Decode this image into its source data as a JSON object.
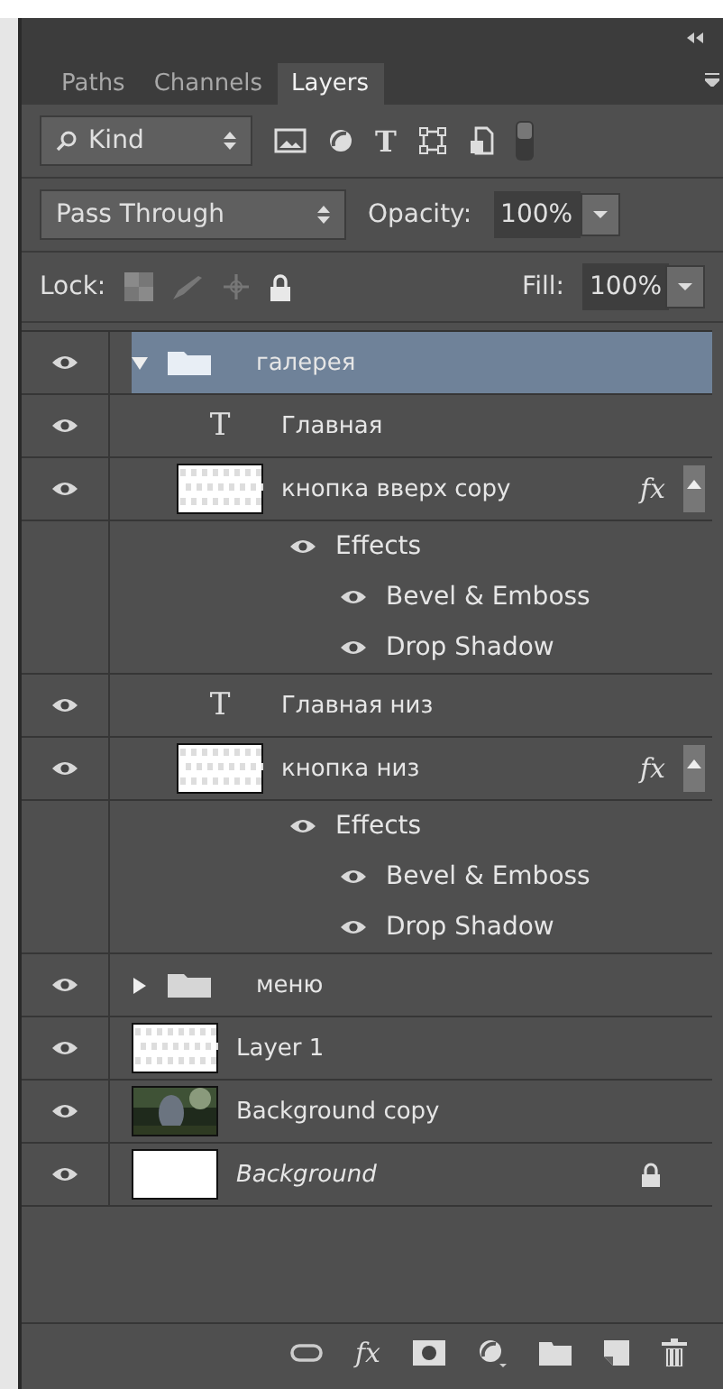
{
  "panel": {
    "tabs": [
      {
        "label": "Paths",
        "selected": false
      },
      {
        "label": "Channels",
        "selected": false
      },
      {
        "label": "Layers",
        "selected": true
      }
    ],
    "filter": {
      "label": "Kind",
      "type_glyph": "T"
    },
    "blend_mode": "Pass Through",
    "opacity_label": "Opacity:",
    "opacity": "100%",
    "lock_label": "Lock:",
    "fill_label": "Fill:",
    "fill": "100%"
  },
  "layers": [
    {
      "kind": "group",
      "name": "галерея",
      "visible": true,
      "selected": true,
      "expanded": true,
      "children": [
        {
          "kind": "text",
          "glyph": "T",
          "name": "Главная",
          "visible": true,
          "selected": false
        },
        {
          "kind": "pixel",
          "thumbnail": {
            "kind": "transparent"
          },
          "name": "кнопка вверх copy",
          "visible": true,
          "selected": false,
          "fx": "fx",
          "effects_expanded": true,
          "effects_label": "Effects",
          "effects": [
            {
              "name": "Bevel & Emboss",
              "visible": true
            },
            {
              "name": "Drop Shadow",
              "visible": true
            }
          ]
        },
        {
          "kind": "text",
          "glyph": "T",
          "name": "Главная низ",
          "visible": true,
          "selected": false
        },
        {
          "kind": "pixel",
          "thumbnail": {
            "kind": "transparent"
          },
          "name": "кнопка низ",
          "visible": true,
          "selected": false,
          "fx": "fx",
          "effects_expanded": true,
          "effects_label": "Effects",
          "effects": [
            {
              "name": "Bevel & Emboss",
              "visible": true
            },
            {
              "name": "Drop Shadow",
              "visible": true
            }
          ]
        }
      ]
    },
    {
      "kind": "group",
      "name": "меню",
      "visible": true,
      "selected": false,
      "expanded": false
    },
    {
      "kind": "pixel",
      "thumbnail": {
        "kind": "transparent"
      },
      "name": "Layer 1",
      "visible": true,
      "selected": false
    },
    {
      "kind": "pixel",
      "name": "Background copy",
      "visible": true,
      "selected": false
    },
    {
      "kind": "background",
      "thumbnail": {
        "kind": "white"
      },
      "name": "Background",
      "visible": true,
      "selected": false,
      "locked": true
    }
  ],
  "footer": {
    "fx": "fx"
  }
}
